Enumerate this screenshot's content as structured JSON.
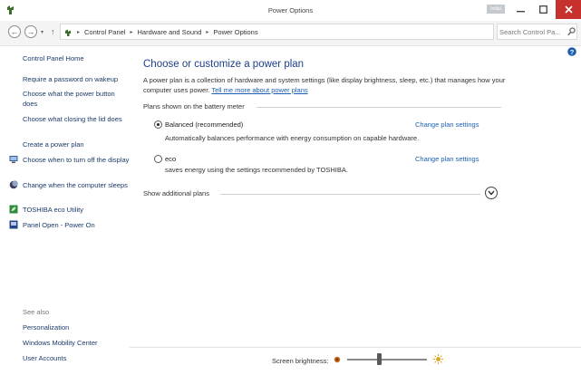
{
  "window": {
    "title": "Power Options",
    "mini_tab": "Initial"
  },
  "address": {
    "crumbs": [
      "Control Panel",
      "Hardware and Sound",
      "Power Options"
    ],
    "search_placeholder": "Search Control Pa..."
  },
  "sidebar": {
    "home": "Control Panel Home",
    "items": [
      {
        "label": "Require a password on wakeup"
      },
      {
        "label": "Choose what the power button does"
      },
      {
        "label": "Choose what closing the lid does"
      },
      {
        "label": "Create a power plan"
      },
      {
        "label": "Choose when to turn off the display",
        "icon": "display-icon"
      },
      {
        "label": "Change when the computer sleeps",
        "icon": "moon-icon"
      },
      {
        "label": "TOSHIBA eco Utility",
        "icon": "eco-utility-icon"
      },
      {
        "label": "Panel Open - Power On",
        "icon": "panel-icon"
      }
    ],
    "see_also_label": "See also",
    "see_also": [
      "Personalization",
      "Windows Mobility Center",
      "User Accounts"
    ]
  },
  "main": {
    "title": "Choose or customize a power plan",
    "description": "A power plan is a collection of hardware and system settings (like display brightness, sleep, etc.) that manages how your computer uses power.",
    "tell_more": "Tell me more about power plans",
    "group_label": "Plans shown on the battery meter",
    "plans": [
      {
        "name": "Balanced (recommended)",
        "desc": "Automatically balances performance with energy consumption on capable hardware.",
        "link": "Change plan settings",
        "selected": true
      },
      {
        "name": "eco",
        "desc": "saves energy using the settings recommended by TOSHIBA.",
        "link": "Change plan settings",
        "selected": false
      }
    ],
    "show_additional": "Show additional plans"
  },
  "footer": {
    "brightness_label": "Screen brightness:",
    "brightness_level": 0.4
  },
  "colors": {
    "link": "#1a5fb4",
    "title": "#1e3f8a",
    "close": "#c7312d"
  }
}
